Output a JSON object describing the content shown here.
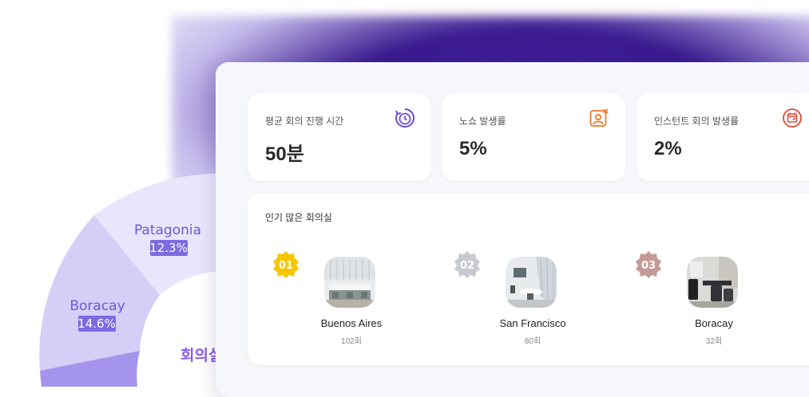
{
  "chart_data": {
    "type": "pie",
    "variant": "donut",
    "slices": [
      {
        "label": "Patagonia",
        "value": 12.3,
        "value_label": "12.3%",
        "color": "#e8e4fb"
      },
      {
        "label": "Boracay",
        "value": 14.6,
        "value_label": "14.6%",
        "color": "#d3ccf6"
      }
    ],
    "partial_title": "회의실"
  },
  "stats": [
    {
      "label": "평균 회의 진행 시간",
      "value": "50분",
      "icon": "clock-icon",
      "color": "#6b4fd8"
    },
    {
      "label": "노쇼 발생률",
      "value": "5%",
      "icon": "user-x-icon",
      "color": "#f07a2a"
    },
    {
      "label": "인스턴트 회의 발생률",
      "value": "2%",
      "icon": "calendar-icon",
      "color": "#e0473a"
    }
  ],
  "popular_rooms": {
    "title": "인기 많은 회의실",
    "items": [
      {
        "rank": "01",
        "name": "Buenos Aires",
        "count": "102회",
        "badge_color": "#f7c600"
      },
      {
        "rank": "02",
        "name": "San Francisco",
        "count": "80회",
        "badge_color": "#c7cad0"
      },
      {
        "rank": "03",
        "name": "Boracay",
        "count": "32회",
        "badge_color": "#c49a96"
      }
    ]
  }
}
